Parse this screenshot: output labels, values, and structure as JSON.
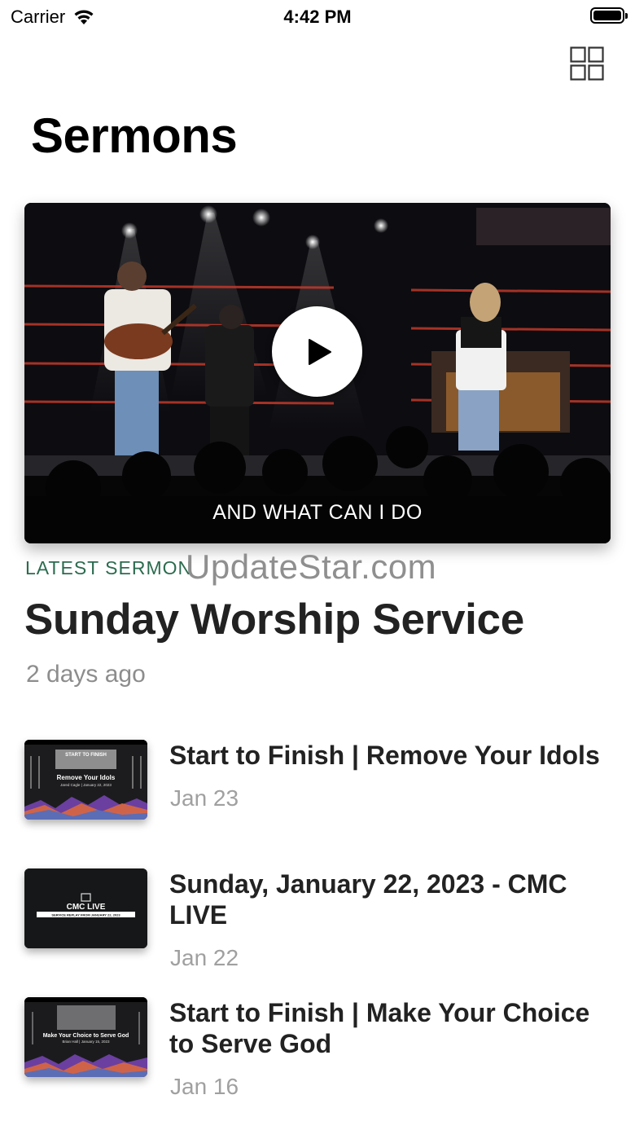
{
  "status_bar": {
    "carrier": "Carrier",
    "time": "4:42 PM"
  },
  "header": {
    "title": "Sermons",
    "layout_icon": "grid-icon"
  },
  "featured": {
    "video_caption": "AND WHAT CAN I DO",
    "label": "LATEST SERMON",
    "watermark": "UpdateStar.com",
    "title": "Sunday Worship Service",
    "meta": "2 days ago"
  },
  "sermons": [
    {
      "title": "Start to Finish | Remove Your Idols",
      "date": "Jan 23",
      "thumb": {
        "top": "START TO FINISH",
        "headline": "Remove Your Idols",
        "sub": "Jared Cagle | January 22, 2023"
      }
    },
    {
      "title": "Sunday, January 22, 2023 - CMC LIVE",
      "date": "Jan 22",
      "thumb": {
        "headline": "CMC LIVE",
        "sub": "SERVICE REPLAY FROM JANUARY 22, 2023"
      }
    },
    {
      "title": "Start to Finish | Make Your Choice to Serve God",
      "date": "Jan 16",
      "thumb": {
        "headline": "Make Your Choice to Serve God",
        "sub": "Brian Hall | January 15, 2023"
      }
    }
  ],
  "colors": {
    "accent": "#2c6b4f",
    "title": "#222222",
    "secondary": "#8d8d8d",
    "stage_light": "#c0392b"
  }
}
